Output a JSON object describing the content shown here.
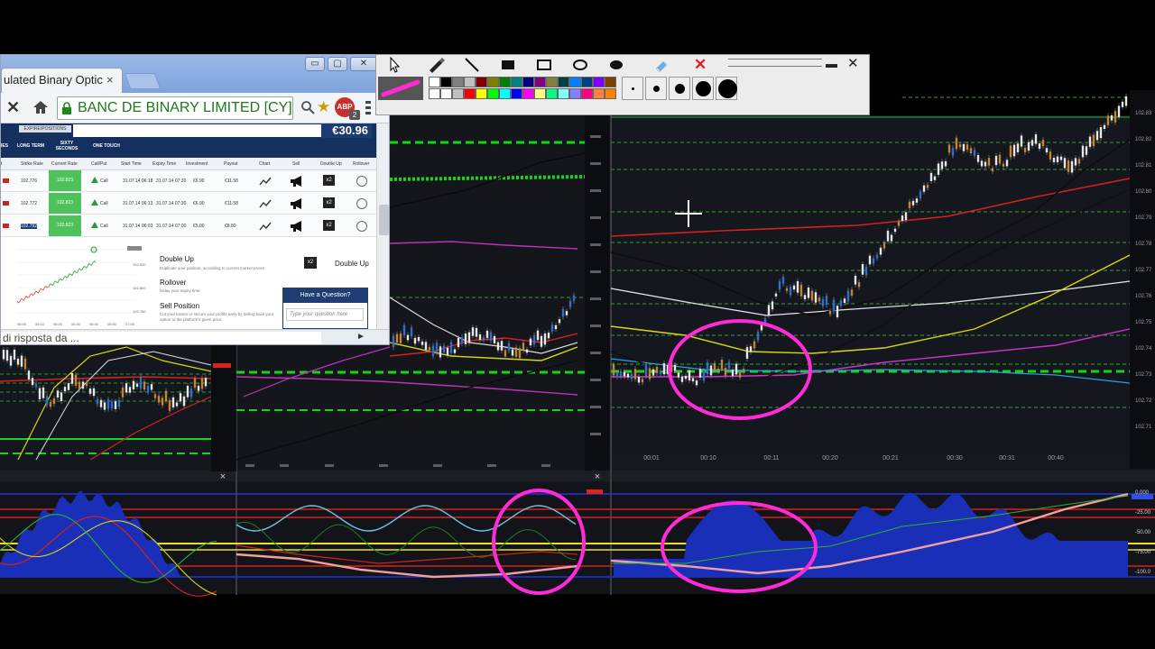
{
  "browser": {
    "tab_title": "ulated Binary Optic",
    "tab_close": "×",
    "window_buttons": {
      "minimize": "▭",
      "maximize": "▢",
      "close": "✕"
    },
    "ev_name": "BANC DE BINARY LIMITED [CY]",
    "adblock_label": "ABP",
    "adblock_count": "2",
    "status_text": "di risposta da ...",
    "status_arrow": "►"
  },
  "trading_page": {
    "expiry_label": "EXPIRE/POSITIONS",
    "balance": "€30.96",
    "type_tabs": [
      "LONG TERM",
      "SIXTY SECONDS",
      "ONE TOUCH"
    ],
    "type_tabs_prefix": "IES",
    "columns": [
      "Strike Rate",
      "Current Rate",
      "Call/Put",
      "Start Time",
      "Expiry Time",
      "Investment",
      "Payout",
      "Chart",
      "Sell",
      "Double Up",
      "Rollover"
    ],
    "column_prefix": "t",
    "rows": [
      {
        "strike": "102.776",
        "current": "102.823",
        "direction": "Call",
        "start": "31.07.14 06:18",
        "expiry": "31.07.14 07:30",
        "investment": "€6.90",
        "payout": "€11.58"
      },
      {
        "strike": "102.772",
        "current": "102.823",
        "direction": "Call",
        "start": "31.07.14 06:13",
        "expiry": "31.07.14 07:30",
        "investment": "€6.90",
        "payout": "€11.58"
      },
      {
        "strike": "102.792",
        "current": "102.823",
        "direction": "Call",
        "start": "31.07.14 06:03",
        "expiry": "31.07.14 07:00",
        "investment": "€5.00",
        "payout": "€8.80"
      }
    ],
    "double_up": {
      "title": "Double Up",
      "desc": "Duplicate your position, according to current market prices",
      "badge": "x2",
      "button": "Double Up"
    },
    "rollover": {
      "title": "Rollover",
      "desc": "Delay your expiry time."
    },
    "sell_position": {
      "title": "Sell Position",
      "desc": "Cut your losses or secure your profits early by selling back your",
      "desc2": "option to the platform's given price."
    },
    "question": {
      "title": "Have a Question?",
      "placeholder": "Type your question here"
    },
    "minichart_ticks": [
      "06:00",
      "06:10",
      "06:20",
      "06:30",
      "06:40",
      "06:50",
      "07:00"
    ],
    "minichart_prices": [
      "102.820",
      "102.800",
      "102.780"
    ]
  },
  "paint_toolbar": {
    "close_tool": "✕",
    "min": "▬",
    "close": "✕",
    "current_color": "#ff2bd6",
    "palette": [
      "#ffffff",
      "#000000",
      "#808080",
      "#c0c0c0",
      "#800000",
      "#808000",
      "#008000",
      "#008080",
      "#000080",
      "#800080",
      "#808040",
      "#004040",
      "#0080ff",
      "#004080",
      "#8000ff",
      "#804000",
      "#ffffff",
      "#ffffff",
      "#c0c0c0",
      "#ff0000",
      "#ffff00",
      "#00ff00",
      "#00ffff",
      "#0000ff",
      "#ff00ff",
      "#ffff80",
      "#00ff80",
      "#80ffff",
      "#8080ff",
      "#ff0080",
      "#ff8040",
      "#ff8000"
    ],
    "tool_icons": [
      "arrow-icon",
      "pen-icon",
      "line-icon",
      "filled-rect-icon",
      "rect-icon",
      "ellipse-icon",
      "filled-ellipse-icon",
      "eraser-icon"
    ]
  },
  "charts": {
    "main_times": [
      "00:01",
      "00:10",
      "00:11",
      "00:20",
      "00:21",
      "00:30",
      "00:31",
      "00:40"
    ],
    "main_prices": [
      "102.83",
      "102.82",
      "102.81",
      "102.80",
      "102.79",
      "102.78",
      "102.77",
      "102.76",
      "102.75",
      "102.74",
      "102.73",
      "102.72",
      "102.71"
    ],
    "osc_levels": [
      "0.000",
      "-25.00",
      "-50.00",
      "-75.00",
      "-100.0"
    ],
    "panel_close": "×"
  }
}
